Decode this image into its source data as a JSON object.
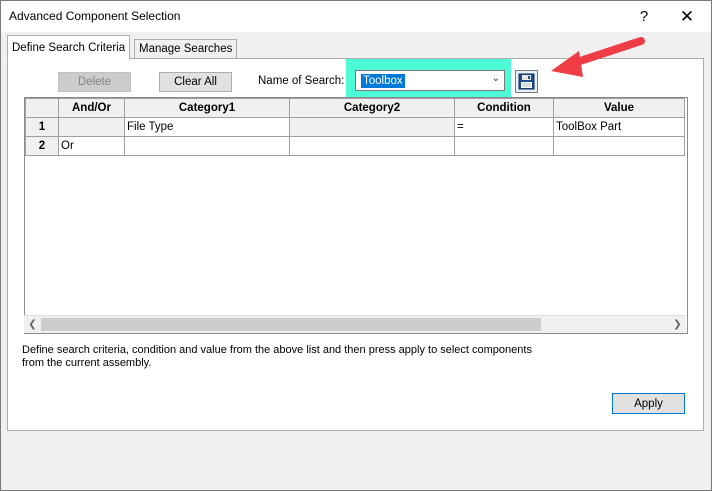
{
  "window": {
    "title": "Advanced Component Selection",
    "help_glyph": "?",
    "close_glyph": "✕"
  },
  "tabs": [
    {
      "label": "Define Search Criteria",
      "active": true
    },
    {
      "label": "Manage Searches",
      "active": false
    }
  ],
  "toolbar": {
    "delete_label": "Delete",
    "clear_all_label": "Clear All",
    "name_of_search_label": "Name of Search:",
    "name_of_search_value": "Toolbox",
    "save_icon": "floppy-disk-icon"
  },
  "grid": {
    "columns": [
      "",
      "And/Or",
      "Category1",
      "Category2",
      "Condition",
      "Value"
    ],
    "rows": [
      {
        "num": "1",
        "and_or": "",
        "category1": "File Type",
        "category2": "",
        "condition": "=",
        "value": "ToolBox Part"
      },
      {
        "num": "2",
        "and_or": "Or",
        "category1": "",
        "category2": "",
        "condition": "",
        "value": ""
      }
    ]
  },
  "description": "Define search criteria, condition and value from the above list and then press apply to select components from the current assembly.",
  "apply_label": "Apply",
  "colors": {
    "highlight": "#4dfcd7",
    "arrow": "#ee3d44",
    "selection": "#0078d7"
  }
}
